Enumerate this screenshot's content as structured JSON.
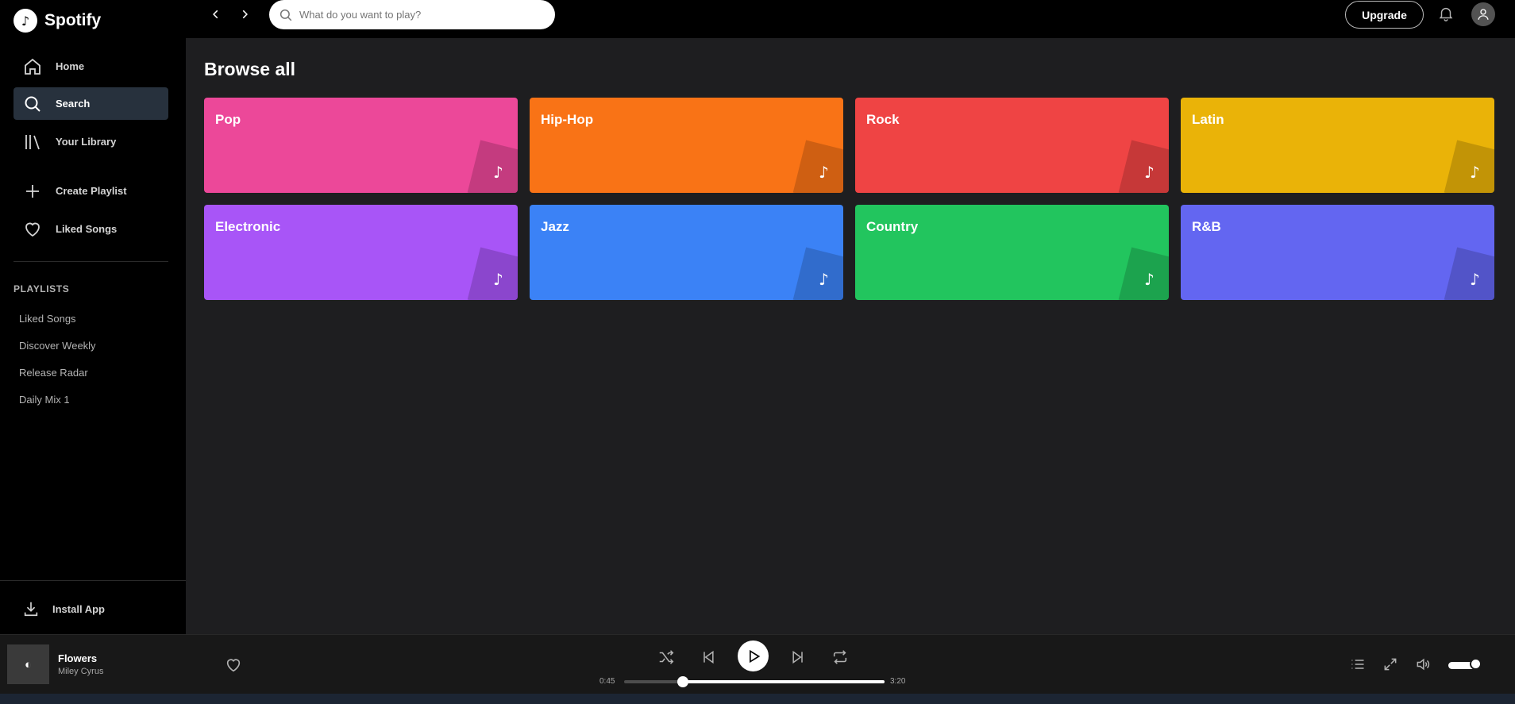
{
  "app": {
    "name": "Spotify",
    "logo_glyph": "♪"
  },
  "sidebar": {
    "nav": [
      {
        "label": "Home",
        "icon": "home-icon"
      },
      {
        "label": "Search",
        "icon": "search-icon",
        "active": true
      },
      {
        "label": "Your Library",
        "icon": "library-icon"
      }
    ],
    "actions": [
      {
        "label": "Create Playlist",
        "icon": "plus-icon"
      },
      {
        "label": "Liked Songs",
        "icon": "heart-icon"
      }
    ],
    "playlists_header": "PLAYLISTS",
    "playlists": [
      "Liked Songs",
      "Discover Weekly",
      "Release Radar",
      "Daily Mix 1"
    ],
    "install_label": "Install App"
  },
  "topbar": {
    "search_placeholder": "What do you want to play?",
    "upgrade_label": "Upgrade"
  },
  "main": {
    "title": "Browse all",
    "genres": [
      {
        "label": "Pop",
        "color": "#ec4899"
      },
      {
        "label": "Hip-Hop",
        "color": "#f97316"
      },
      {
        "label": "Rock",
        "color": "#ef4444"
      },
      {
        "label": "Latin",
        "color": "#eab308"
      },
      {
        "label": "Electronic",
        "color": "#a855f7"
      },
      {
        "label": "Jazz",
        "color": "#3b82f6"
      },
      {
        "label": "Country",
        "color": "#22c55e"
      },
      {
        "label": "R&B",
        "color": "#6366f1"
      }
    ],
    "card_glyph": "♪"
  },
  "player": {
    "track_title": "Flowers",
    "artist": "Miley Cyrus",
    "thumb_glyph": "◐",
    "current_time": "0:45",
    "total_time": "3:20",
    "progress_fraction": 0.225,
    "volume_fraction": 1.0
  }
}
